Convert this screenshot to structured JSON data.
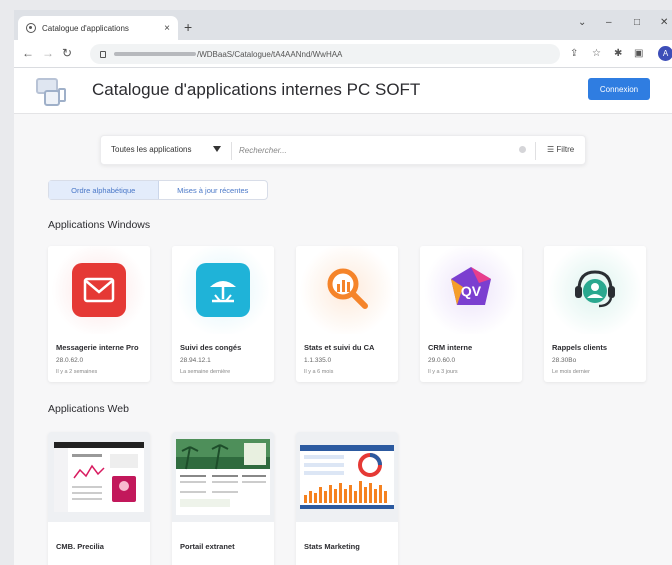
{
  "browser": {
    "tab_title": "Catalogue d'applications",
    "tab_close": "×",
    "new_tab": "+",
    "url_path": "/WDBaaS/Catalogue/tA4AANnd/WwHAA",
    "profile_initial": "A"
  },
  "header": {
    "title": "Catalogue d'applications internes PC SOFT",
    "login_label": "Connexion"
  },
  "search": {
    "filter_label": "Toutes les applications",
    "placeholder": "Rechercher...",
    "filter_button": "Filtre"
  },
  "sort_tabs": [
    {
      "label": "Ordre alphabétique",
      "active": true
    },
    {
      "label": "Mises à jour récentes",
      "active": false
    }
  ],
  "sections": {
    "windows_title": "Applications Windows",
    "web_title": "Applications Web"
  },
  "windows_apps": [
    {
      "name": "Messagerie interne Pro",
      "version": "28.0.62.0",
      "updated": "Il y a 2 semaines",
      "icon": "mail-icon",
      "color": "#e53935",
      "glow": "#fbe3e3"
    },
    {
      "name": "Suivi des congés",
      "version": "28.94.12.1",
      "updated": "La semaine dernière",
      "icon": "beach-umbrella-icon",
      "color": "#1fb3d8",
      "glow": "#dff4fa"
    },
    {
      "name": "Stats et suivi du CA",
      "version": "1.1.335.0",
      "updated": "Il y a 6 mois",
      "icon": "magnifier-chart-icon",
      "color": "#f5842a",
      "glow": "#fdeadb"
    },
    {
      "name": "CRM interne",
      "version": "29.0.60.0",
      "updated": "Il y a 3 jours",
      "icon": "qv-logo-icon",
      "color": "#7b3fd0",
      "glow": "#ece3fa"
    },
    {
      "name": "Rappels clients",
      "version": "28.30Bo",
      "updated": "Le mois dernier",
      "icon": "headset-icon",
      "color": "#2aa88f",
      "glow": "#ddf3ee"
    }
  ],
  "web_apps": [
    {
      "name": "CMB. Precilia"
    },
    {
      "name": "Portail extranet"
    },
    {
      "name": "Stats Marketing"
    }
  ]
}
